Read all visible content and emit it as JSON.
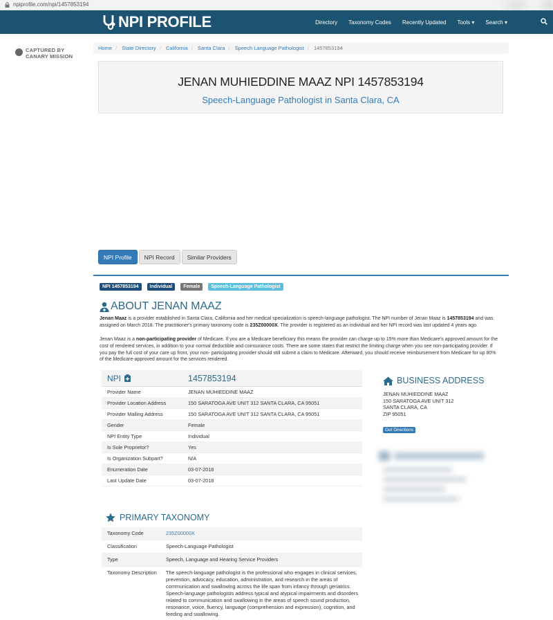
{
  "browser": {
    "url": "npiprofile.com/npi/1457853194"
  },
  "navbar": {
    "brand": "NPI PROFILE",
    "links": [
      "Directory",
      "Taxonomy Codes",
      "Recently Updated",
      "Tools ▾",
      "Search ▾"
    ]
  },
  "captured": {
    "line1": "CAPTURED BY",
    "line2": "CANARY MISSION"
  },
  "breadcrumb": [
    "Home",
    "State Directory",
    "California",
    "Santa Clara",
    "Speech Language Pathologist"
  ],
  "breadcrumb_current": "1457853194",
  "hero": {
    "title": "JENAN MUHIEDDINE MAAZ NPI 1457853194",
    "subtitle": "Speech-Language Pathologist in Santa Clara, CA"
  },
  "tabs": [
    "NPI Profile",
    "NPI Record",
    "Similar Providers"
  ],
  "badges": [
    {
      "text": "NPI 1457853194",
      "color": "#1f4e79"
    },
    {
      "text": "Individual",
      "color": "#1f4e79"
    },
    {
      "text": "Female",
      "color": "#777777"
    },
    {
      "text": "Speech-Language Pathologist",
      "color": "#5bc0de"
    }
  ],
  "about": {
    "heading": "ABOUT JENAN MAAZ",
    "p1_name": "Jenan Maaz",
    "p1_a": " is a provider established in Santa Clara, California and her medical specialization is speech-language pathologist. The NPI number of Jenan Maaz is ",
    "p1_npi": "1457853194",
    "p1_b": " and was assigned on March 2018. The practitioner's primary taxonomy code is ",
    "p1_code": "235Z00000X",
    "p1_c": ". The provider is registered as an individual and her NPI record was last updated 4 years ago.",
    "p2_a": "Jenan Maaz is a ",
    "p2_bold": "non-participating provider",
    "p2_b": " of Medicare. If you are a Medicare beneficiary this means the provider can charge up to 15% more than Medicare's approved amount for the cost of rendered services, in addition to your normal deductible and coinsurance costs. There are some states that restrict the limiting charge when you see non-participating provider. If you pay the full cost of your care up front, your non- participating provider should still submit a claim to Medicare. Afterward, you should receive reimbursement from Medicare for up 80% of the Medicare-approved amount for the services rendered."
  },
  "npi_table": {
    "head_label": "NPI",
    "head_value": "1457853194",
    "rows": [
      [
        "Provider Name",
        "JENAN MUHIEDDINE MAAZ"
      ],
      [
        "Provider Location Address",
        "150 SARATOGA AVE UNIT 312 SANTA CLARA, CA 95051"
      ],
      [
        "Provider Mailing Address",
        "150 SARATOGA AVE UNIT 312 SANTA CLARA, CA 95051"
      ],
      [
        "Gender",
        "Female"
      ],
      [
        "NPI Entity Type",
        "Individual"
      ],
      [
        "Is Sole Proprietor?",
        "Yes"
      ],
      [
        "Is Organization Subpart?",
        "N/A"
      ],
      [
        "Enumeration Date",
        "03-07-2018"
      ],
      [
        "Last Update Date",
        "03-07-2018"
      ]
    ]
  },
  "business": {
    "heading": "BUSINESS ADDRESS",
    "lines": [
      "JENAN MUHIEDDINE MAAZ",
      "150 SARATOGA AVE UNIT 312",
      "SANTA CLARA, CA",
      "ZIP 95051"
    ],
    "button": "Get Directions"
  },
  "taxonomy": {
    "heading": "PRIMARY TAXONOMY",
    "rows": [
      [
        "Taxonomy Code",
        "235Z00000X"
      ],
      [
        "Classification",
        "Speech-Language Pathologist"
      ],
      [
        "Type",
        "Speech, Language and Hearing Service Providers"
      ],
      [
        "Taxonomy Description",
        "The speech-language pathologist is the professional who engages in clinical services, prevention, advocacy, education, administration, and research in the areas of communication and swallowing across the life span from infancy through geriatrics. Speech-language pathologists address typical and atypical impairments and disorders related to communication and swallowing in the areas of speech sound production, resonance, voice, fluency, language (comprehension and expression), cognition, and feeding and swallowing."
      ]
    ]
  }
}
